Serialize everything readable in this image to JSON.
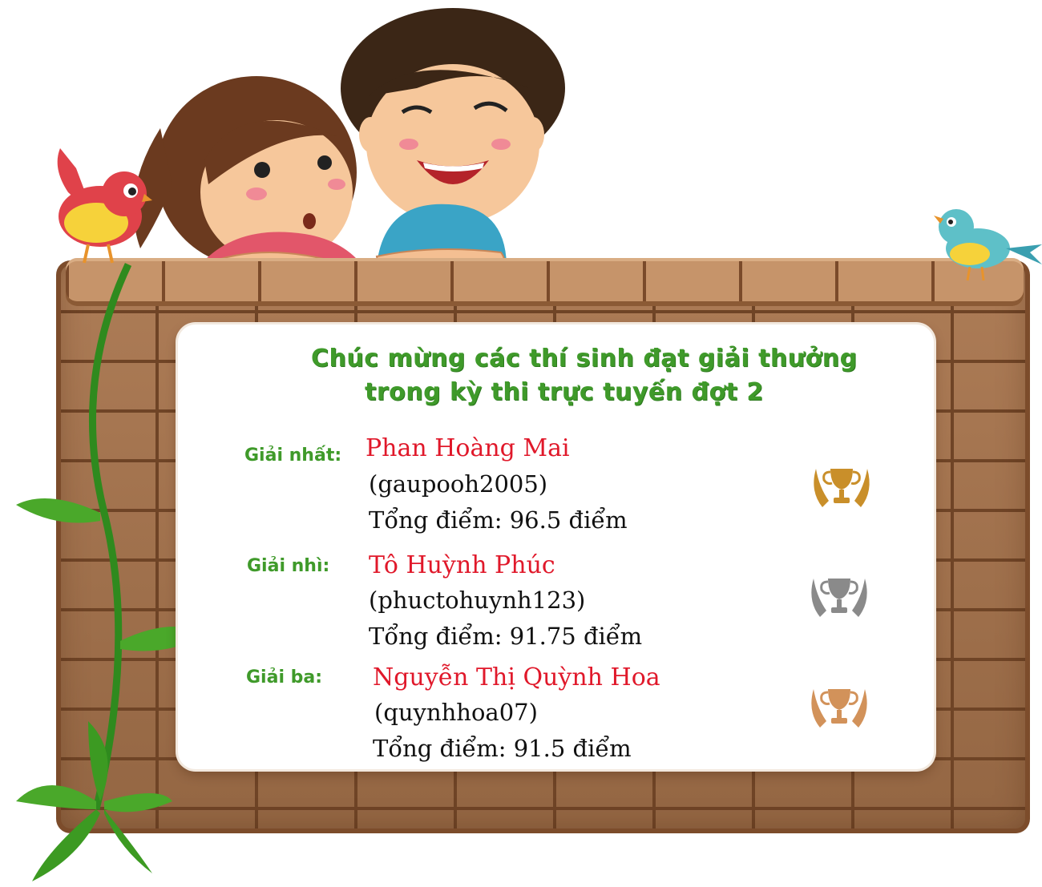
{
  "heading": {
    "line1": "Chúc mừng các thí sinh đạt giải thưởng",
    "line2": "trong kỳ thi trực tuyến đợt 2"
  },
  "awards": [
    {
      "label": "Giải nhất:",
      "name": "Phan Hoàng Mai",
      "username": "(gaupooh2005)",
      "score": "Tổng điểm: 96.5 điểm",
      "trophy_icon": "gold-trophy-icon",
      "color": "#c98f2a"
    },
    {
      "label": "Giải nhì:",
      "name": "Tô Huỳnh Phúc",
      "username": "(phuctohuynh123)",
      "score": "Tổng điểm: 91.75 điểm",
      "trophy_icon": "silver-trophy-icon",
      "color": "#8a8a8a"
    },
    {
      "label": "Giải ba:",
      "name": "Nguyễn Thị Quỳnh Hoa",
      "username": "(quynhhoa07)",
      "score": "Tổng điểm: 91.5 điểm",
      "trophy_icon": "bronze-trophy-icon",
      "color": "#d2925a"
    }
  ],
  "colors": {
    "heading": "#3f9a2a",
    "name": "#e0182a",
    "brick": "#a8744c",
    "mortar": "#6f4426"
  }
}
